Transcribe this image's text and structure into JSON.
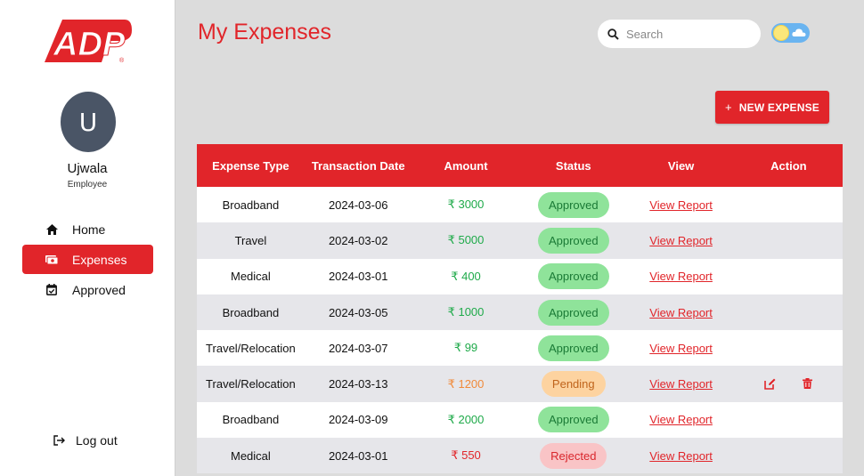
{
  "brand": {
    "logo_text": "ADP",
    "accent": "#e1252a"
  },
  "user": {
    "initial": "U",
    "name": "Ujwala",
    "role": "Employee"
  },
  "nav": [
    {
      "label": "Home",
      "icon": "home-icon"
    },
    {
      "label": "Expenses",
      "icon": "money-icon",
      "active": true
    },
    {
      "label": "Approved",
      "icon": "calendar-check-icon"
    }
  ],
  "logout": {
    "label": "Log out",
    "icon": "logout-icon"
  },
  "header": {
    "title": "My Expenses",
    "search_placeholder": "Search",
    "theme_toggle": "light"
  },
  "new_expense": {
    "label": "NEW EXPENSE",
    "icon": "plus"
  },
  "table": {
    "columns": [
      "Expense Type",
      "Transaction Date",
      "Amount",
      "Status",
      "View",
      "Action"
    ],
    "rows": [
      {
        "type": "Broadband",
        "date": "2024-03-06",
        "amount": "₹ 3000",
        "status": "Approved",
        "view": "View Report"
      },
      {
        "type": "Travel",
        "date": "2024-03-02",
        "amount": "₹ 5000",
        "status": "Approved",
        "view": "View Report"
      },
      {
        "type": "Medical",
        "date": "2024-03-01",
        "amount": "₹ 400",
        "status": "Approved",
        "view": "View Report"
      },
      {
        "type": "Broadband",
        "date": "2024-03-05",
        "amount": "₹ 1000",
        "status": "Approved",
        "view": "View Report"
      },
      {
        "type": "Travel/Relocation",
        "date": "2024-03-07",
        "amount": "₹ 99",
        "status": "Approved",
        "view": "View Report"
      },
      {
        "type": "Travel/Relocation",
        "date": "2024-03-13",
        "amount": "₹ 1200",
        "status": "Pending",
        "view": "View Report",
        "actions": [
          "edit-icon",
          "trash-icon"
        ]
      },
      {
        "type": "Broadband",
        "date": "2024-03-09",
        "amount": "₹ 2000",
        "status": "Approved",
        "view": "View Report"
      },
      {
        "type": "Medical",
        "date": "2024-03-01",
        "amount": "₹ 550",
        "status": "Rejected",
        "view": "View Report"
      }
    ]
  },
  "status_colors": {
    "Approved": "#8fe39a",
    "Pending": "#fdd3a0",
    "Rejected": "#f9c4c6"
  }
}
